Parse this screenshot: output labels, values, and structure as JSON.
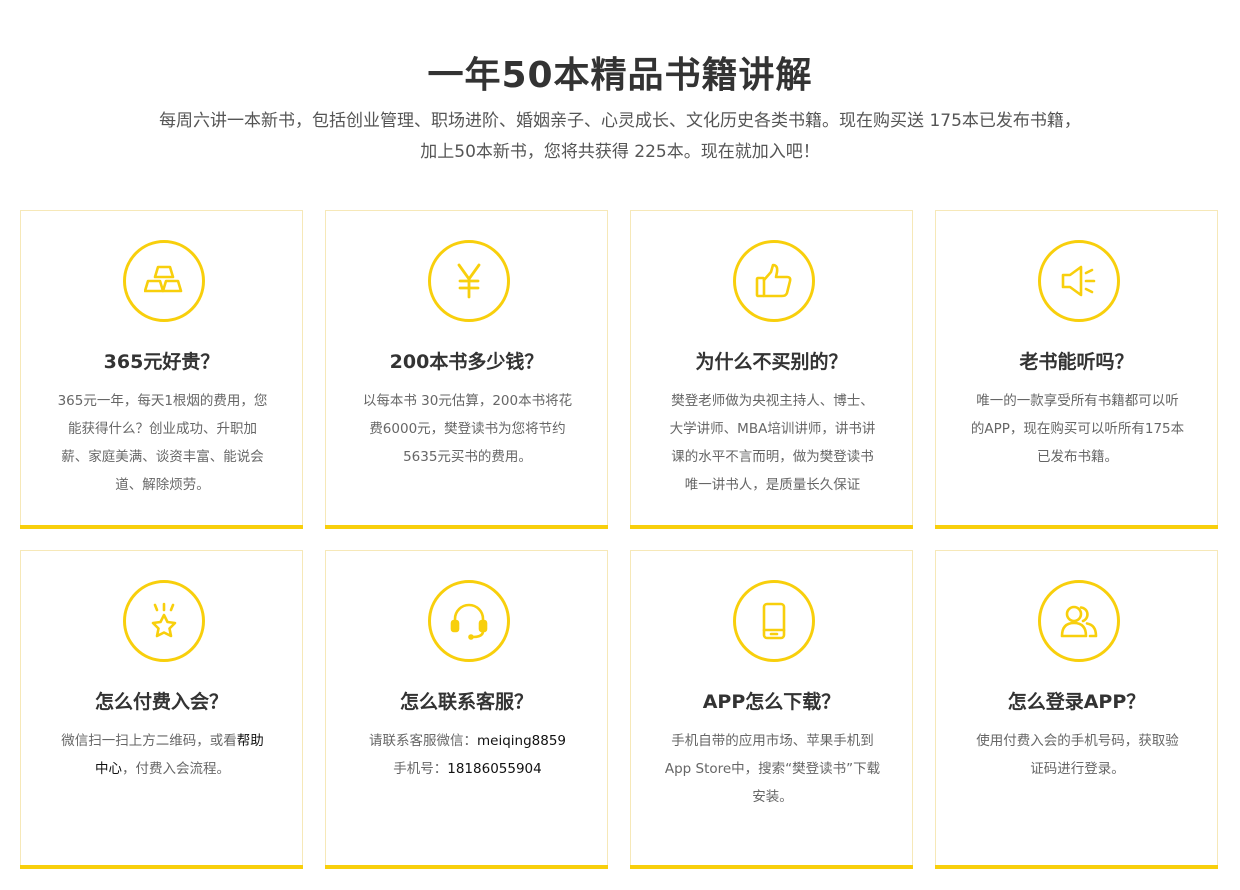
{
  "header": {
    "title": "一年50本精品书籍讲解",
    "subtitle_line1": "每周六讲一本新书，包括创业管理、职场进阶、婚姻亲子、心灵成长、文化历史各类书籍。现在购买送 175本已发布书籍，",
    "subtitle_line2": "加上50本新书，您将共获得 225本。现在就加入吧！"
  },
  "colors": {
    "accent": "#f8cf0c",
    "border": "#f6e8b8"
  },
  "cards": [
    {
      "icon": "gold-bars-icon",
      "title": "365元好贵？",
      "lines": [
        "365元一年，每天1根烟的费用，您",
        "能获得什么？创业成功、升职加",
        "薪、家庭美满、谈资丰富、能说会",
        "道、解除烦劳。"
      ]
    },
    {
      "icon": "yen-icon",
      "title": "200本书多少钱？",
      "lines": [
        "以每本书 30元估算，200本书将花",
        "费6000元，樊登读书为您将节约",
        "5635元买书的费用。"
      ]
    },
    {
      "icon": "thumbs-up-icon",
      "title": "为什么不买别的？",
      "lines": [
        "樊登老师做为央视主持人、博士、",
        "大学讲师、MBA培训讲师，讲书讲",
        "课的水平不言而明，做为樊登读书",
        "唯一讲书人，是质量长久保证"
      ]
    },
    {
      "icon": "speaker-icon",
      "title": "老书能听吗？",
      "lines": [
        "唯一的一款享受所有书籍都可以听",
        "的APP，现在购买可以听所有175本",
        "已发布书籍。"
      ]
    },
    {
      "icon": "star-icon",
      "title": "怎么付费入会？",
      "line1_pre": "微信扫一扫上方二维码，或看",
      "line1_link": "帮助",
      "line2_link": "中心",
      "line2_post": "，付费入会流程。"
    },
    {
      "icon": "headset-icon",
      "title": "怎么联系客服？",
      "wechat_label": "请联系客服微信：",
      "wechat_value": "meiqing8859",
      "phone_label": "手机号：",
      "phone_value": "18186055904"
    },
    {
      "icon": "phone-icon",
      "title": "APP怎么下载？",
      "lines": [
        "手机自带的应用市场、苹果手机到",
        "App Store中，搜索“樊登读书”下载",
        "安装。"
      ]
    },
    {
      "icon": "users-icon",
      "title": "怎么登录APP？",
      "lines": [
        "使用付费入会的手机号码，获取验",
        "证码进行登录。"
      ]
    }
  ]
}
